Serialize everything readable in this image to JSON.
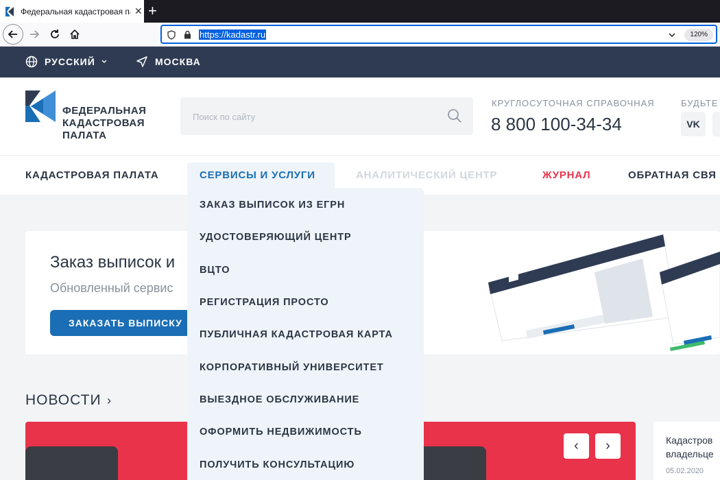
{
  "browser": {
    "tab_title": "Федеральная кадастровая па",
    "tab_close": "✕",
    "new_tab": "+",
    "url": "https://kadastr.ru",
    "zoom": "120%"
  },
  "topbar": {
    "language": "РУССКИЙ",
    "city": "МОСКВА"
  },
  "header": {
    "logo_lines": [
      "ФЕДЕРАЛЬНАЯ",
      "КАДАСТРОВАЯ",
      "ПАЛАТА"
    ],
    "search_placeholder": "Поиск по сайту",
    "hotline_label": "КРУГЛОСУТОЧНАЯ СПРАВОЧНАЯ",
    "hotline_number": "8 800 100-34-34",
    "social_label": "БУДЬТЕ",
    "vk": "VK"
  },
  "menu": {
    "items": [
      {
        "label": "КАДАСТРОВАЯ ПАЛАТА",
        "color": "#2c3544"
      },
      {
        "label": "СЕРВИСЫ И УСЛУГИ",
        "color": "#1a6eb5"
      },
      {
        "label": "АНАЛИТИЧЕСКИЙ ЦЕНТР",
        "color": "#d3d7dd"
      },
      {
        "label": "ЖУРНАЛ",
        "color": "#e8334a"
      },
      {
        "label": "ОБРАТНАЯ СВЯ",
        "color": "#2c3544"
      }
    ]
  },
  "dropdown": {
    "items": [
      "ЗАКАЗ ВЫПИСОК ИЗ ЕГРН",
      "УДОСТОВЕРЯЮЩИЙ ЦЕНТР",
      "ВЦТО",
      "РЕГИСТРАЦИЯ ПРОСТО",
      "ПУБЛИЧНАЯ КАДАСТРОВАЯ КАРТА",
      "КОРПОРАТИВНЫЙ УНИВЕРСИТЕТ",
      "ВЫЕЗДНОЕ ОБСЛУЖИВАНИЕ",
      "ОФОРМИТЬ НЕДВИЖИМОСТЬ",
      "ПОЛУЧИТЬ КОНСУЛЬТАЦИЮ"
    ]
  },
  "banner": {
    "title": "Заказ выписок и",
    "subtitle": "Обновленный сервис",
    "button": "ЗАКАЗАТЬ ВЫПИСКУ"
  },
  "news": {
    "title": "НОВОСТИ",
    "arrow": "›",
    "prev": "‹",
    "next": "›",
    "side_line1": "Кадастров",
    "side_line2": "владельце",
    "side_date": "05.02.2020"
  },
  "colors": {
    "brand_dark": "#2f3b52",
    "brand_blue": "#1a6eb5",
    "accent_red": "#e8334a"
  }
}
